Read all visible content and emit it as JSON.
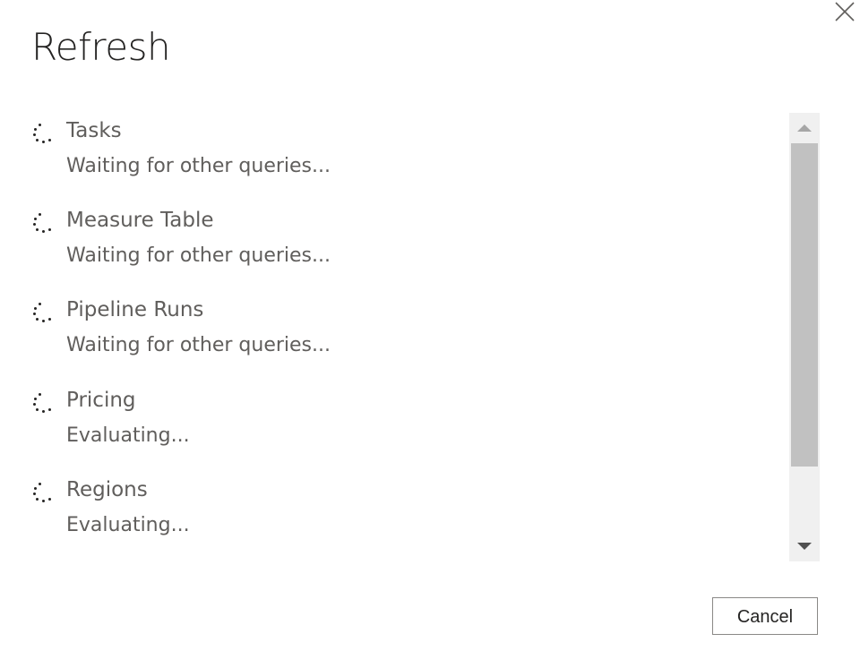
{
  "dialog": {
    "title": "Refresh",
    "close_icon": "close-icon"
  },
  "queries": [
    {
      "name": "Tasks",
      "status": "Waiting for other queries..."
    },
    {
      "name": "Measure Table",
      "status": "Waiting for other queries..."
    },
    {
      "name": "Pipeline Runs",
      "status": "Waiting for other queries..."
    },
    {
      "name": "Pricing",
      "status": "Evaluating..."
    },
    {
      "name": "Regions",
      "status": "Evaluating..."
    }
  ],
  "footer": {
    "cancel_label": "Cancel"
  },
  "icons": {
    "spinner": "loading-spinner-icon",
    "scroll_up": "scroll-up-arrow-icon",
    "scroll_down": "scroll-down-arrow-icon"
  },
  "colors": {
    "title_text": "#252423",
    "secondary_text": "#605e5c",
    "scroll_track": "#f0f0f0",
    "scroll_thumb": "#c1c1c1",
    "button_border": "#8a8886"
  }
}
